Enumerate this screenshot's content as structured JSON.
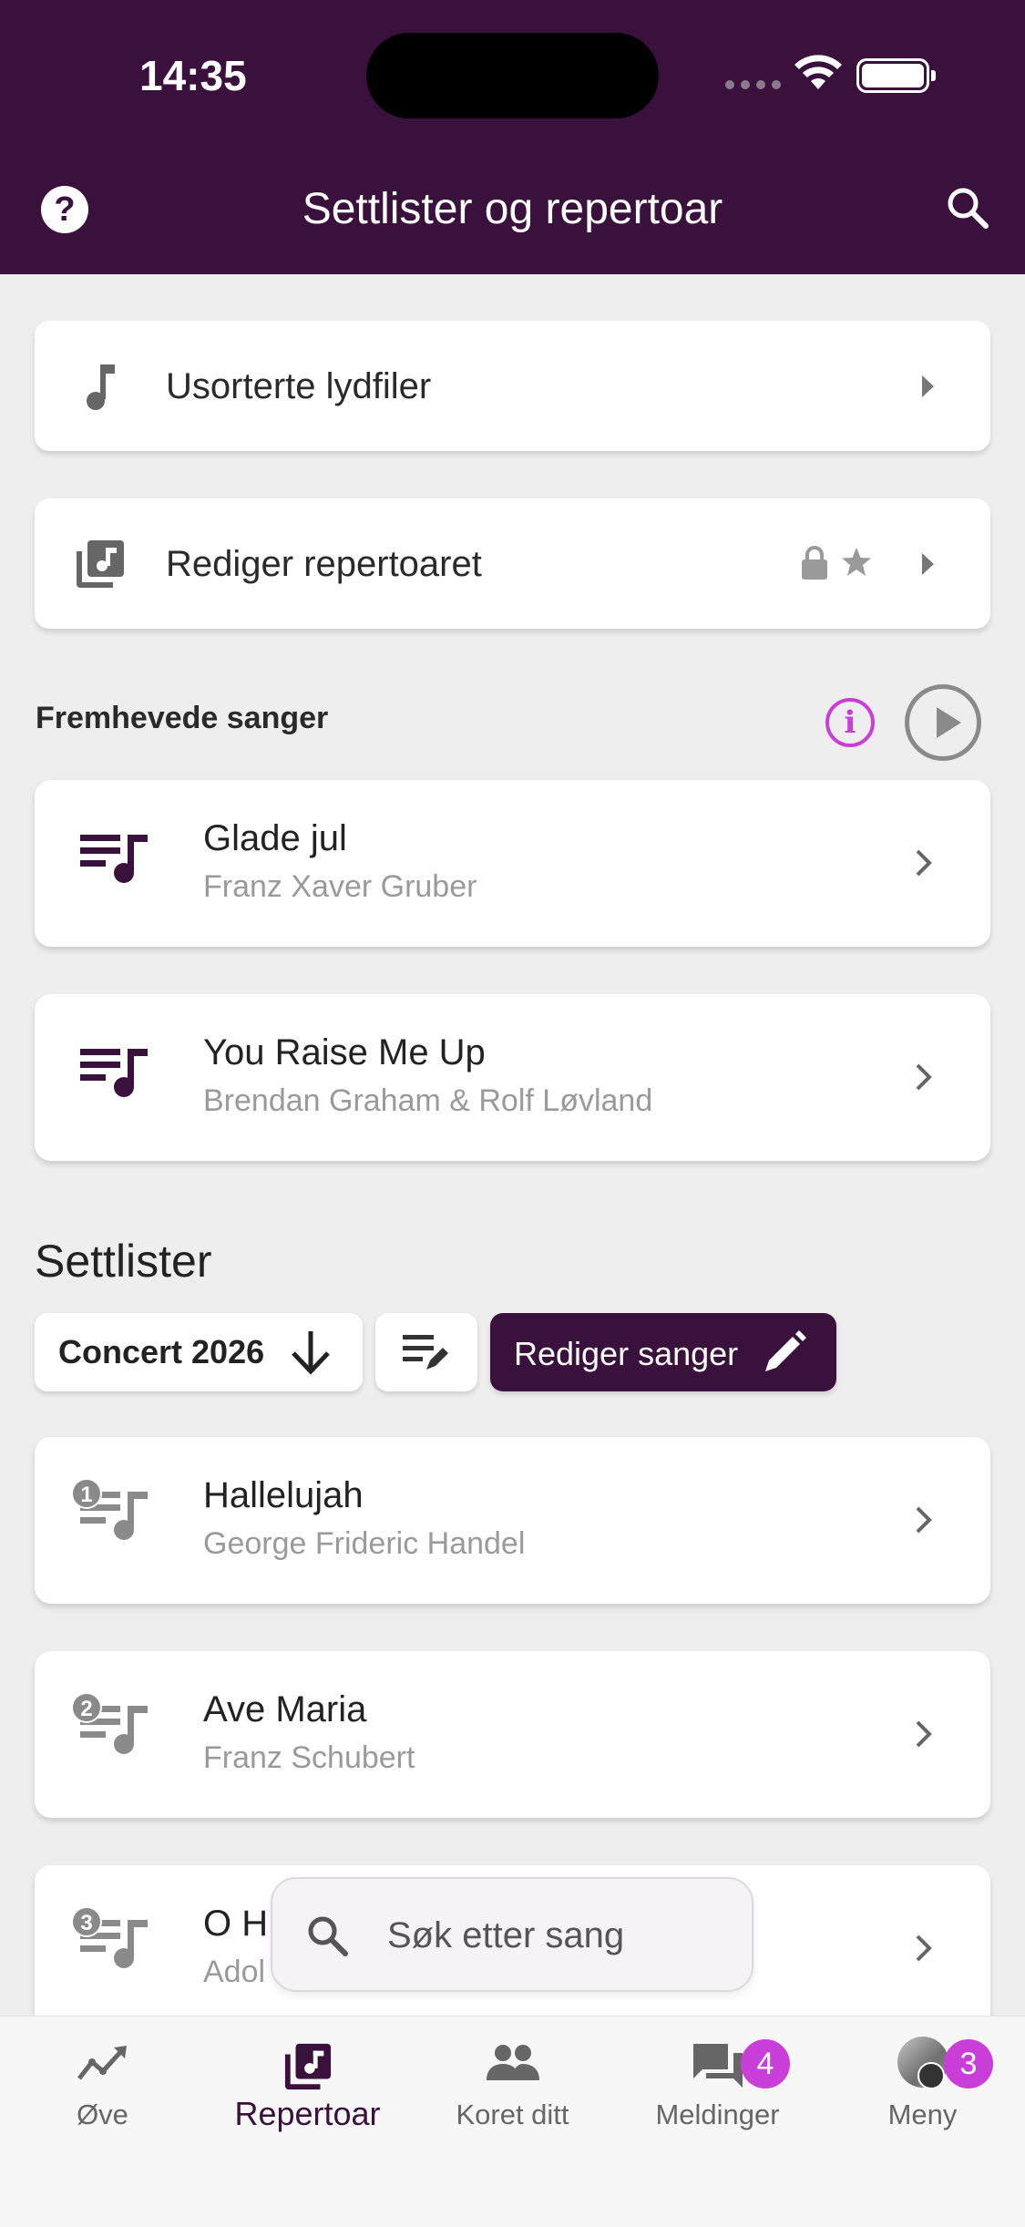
{
  "status_bar": {
    "time": "14:35"
  },
  "header": {
    "title": "Settlister og repertoar",
    "help_icon": "help-circle-icon",
    "search_icon": "search-icon",
    "background": "#3a113c"
  },
  "menu_cards": [
    {
      "label": "Usorterte lydfiler",
      "icon": "music-note-icon"
    },
    {
      "label": "Rediger repertoaret",
      "icon": "library-music-icon",
      "extra_icons": [
        "lock-icon",
        "star-icon"
      ]
    }
  ],
  "featured": {
    "heading": "Fremhevede sanger",
    "accent": "#c93ed8",
    "songs": [
      {
        "title": "Glade jul",
        "composer": "Franz Xaver Gruber"
      },
      {
        "title": "You Raise Me Up",
        "composer": "Brendan Graham & Rolf Løvland"
      }
    ]
  },
  "setlists": {
    "heading": "Settlister",
    "selected": "Concert 2026",
    "edit_songs_label": "Rediger sanger",
    "songs": [
      {
        "number": "1",
        "title": "Hallelujah",
        "composer": "George Frideric Handel"
      },
      {
        "number": "2",
        "title": "Ave Maria",
        "composer": "Franz Schubert"
      },
      {
        "number": "3",
        "title": "O H",
        "composer": "Adol"
      }
    ]
  },
  "search": {
    "placeholder": "Søk etter sang"
  },
  "bottom_nav": {
    "items": [
      {
        "label": "Øve",
        "icon": "trending-icon"
      },
      {
        "label": "Repertoar",
        "icon": "library-music-icon",
        "active": true
      },
      {
        "label": "Koret ditt",
        "icon": "people-icon"
      },
      {
        "label": "Meldinger",
        "icon": "forum-icon",
        "badge": "4"
      },
      {
        "label": "Meny",
        "icon": "avatar-icon",
        "badge": "3"
      }
    ]
  }
}
